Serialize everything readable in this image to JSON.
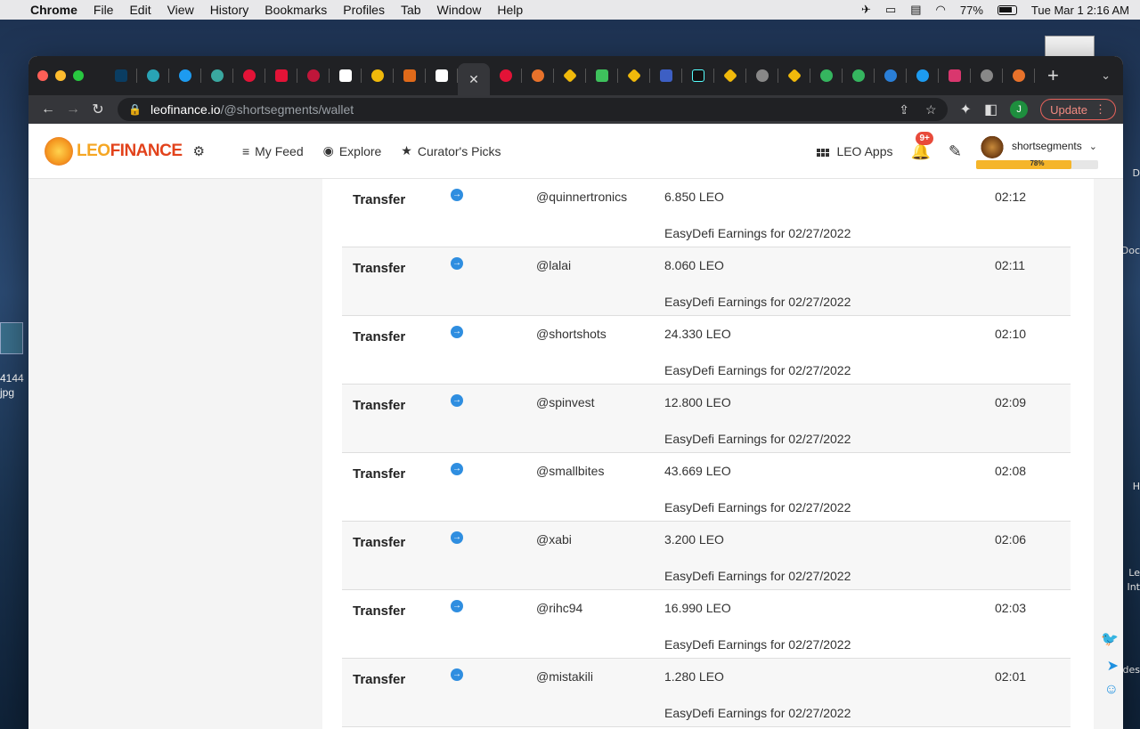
{
  "menubar": {
    "apple": "",
    "app": "Chrome",
    "items": [
      "File",
      "Edit",
      "View",
      "History",
      "Bookmarks",
      "Profiles",
      "Tab",
      "Window",
      "Help"
    ],
    "battery": "77%",
    "datetime": "Tue Mar 1  2:16 AM"
  },
  "desktop": {
    "left_text_1": "4144",
    "left_text_2": "jpg",
    "right_labels": [
      "D",
      "Doc",
      "H",
      "Le",
      "Int",
      "des"
    ]
  },
  "browser": {
    "url_host": "leofinance.io",
    "url_path": "/@shortsegments/wallet",
    "profile_initial": "J",
    "update_label": "Update",
    "close_tab": "✕",
    "new_tab": "+"
  },
  "site": {
    "logo_leo": "LEO",
    "logo_finance": "FINANCE",
    "nav": [
      "My Feed",
      "Explore",
      "Curator's Picks"
    ],
    "apps_label": "LEO Apps",
    "notif_badge": "9+",
    "username": "shortsegments",
    "progress_label": "78%",
    "progress_value": 0.78
  },
  "transactions": [
    {
      "type": "Transfer",
      "user": "@quinnertronics",
      "amount": "6.850 LEO",
      "memo": "EasyDefi Earnings for 02/27/2022",
      "time": "02:12"
    },
    {
      "type": "Transfer",
      "user": "@lalai",
      "amount": "8.060 LEO",
      "memo": "EasyDefi Earnings for 02/27/2022",
      "time": "02:11"
    },
    {
      "type": "Transfer",
      "user": "@shortshots",
      "amount": "24.330 LEO",
      "memo": "EasyDefi Earnings for 02/27/2022",
      "time": "02:10"
    },
    {
      "type": "Transfer",
      "user": "@spinvest",
      "amount": "12.800 LEO",
      "memo": "EasyDefi Earnings for 02/27/2022",
      "time": "02:09"
    },
    {
      "type": "Transfer",
      "user": "@smallbites",
      "amount": "43.669 LEO",
      "memo": "EasyDefi Earnings for 02/27/2022",
      "time": "02:08"
    },
    {
      "type": "Transfer",
      "user": "@xabi",
      "amount": "3.200 LEO",
      "memo": "EasyDefi Earnings for 02/27/2022",
      "time": "02:06"
    },
    {
      "type": "Transfer",
      "user": "@rihc94",
      "amount": "16.990 LEO",
      "memo": "EasyDefi Earnings for 02/27/2022",
      "time": "02:03"
    },
    {
      "type": "Transfer",
      "user": "@mistakili",
      "amount": "1.280 LEO",
      "memo": "EasyDefi Earnings for 02/27/2022",
      "time": "02:01"
    }
  ],
  "colors": {
    "accent": "#2f8ee0",
    "leo_orange": "#f5a623",
    "finance_red": "#e2421b",
    "progress": "#f5b52a"
  }
}
